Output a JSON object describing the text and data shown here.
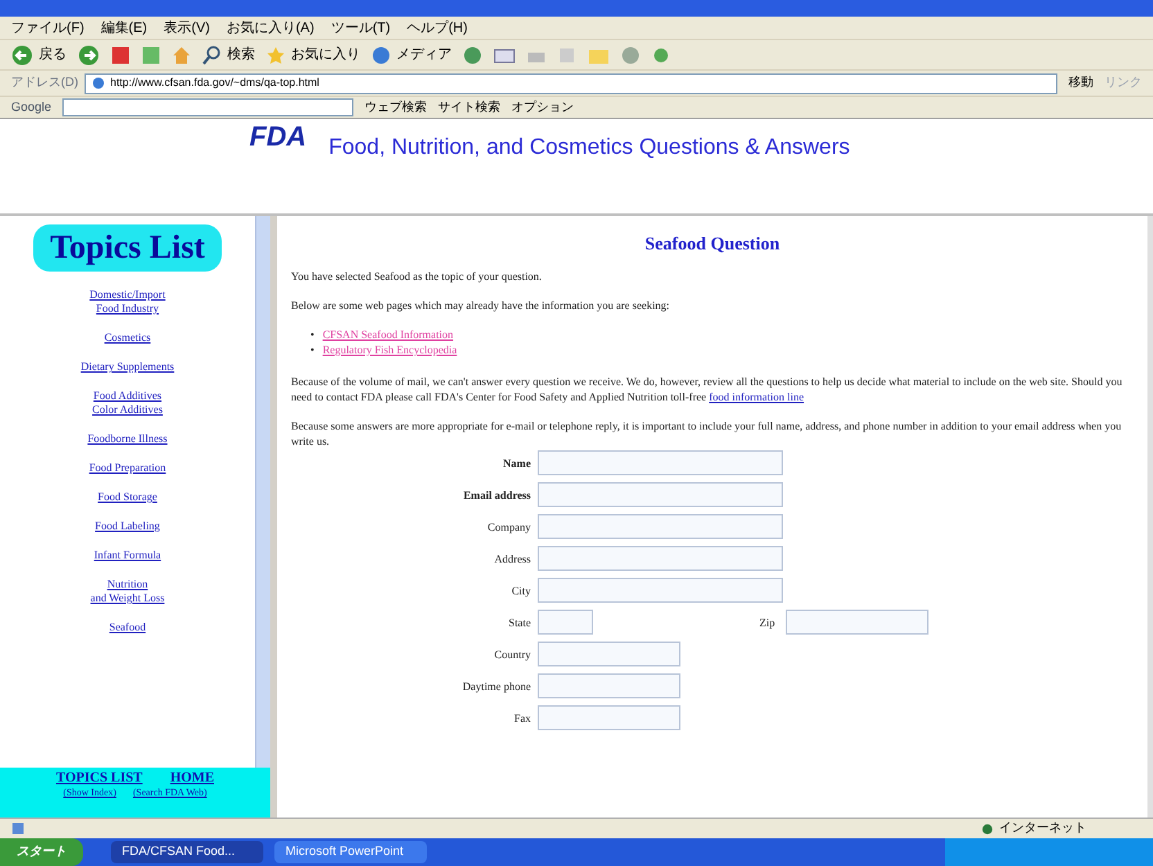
{
  "menu_bar": [
    "ファイル(F)",
    "編集(E)",
    "表示(V)",
    "お気に入り(A)",
    "ツール(T)",
    "ヘルプ(H)"
  ],
  "toolbar": {
    "back": "戻る",
    "search": "検索",
    "favorites": "お気に入り",
    "media": "メディア"
  },
  "address_bar": {
    "label": "アドレス(D)",
    "url": "http://www.cfsan.fda.gov/~dms/qa-top.html",
    "go": "移動",
    "links": "リンク"
  },
  "google_bar": {
    "label": "Google",
    "web_search": "ウェブ検索",
    "site_search": "サイト検索",
    "options": "オプション"
  },
  "banner": {
    "logo": "FDA",
    "title": "Food, Nutrition, and Cosmetics Questions & Answers"
  },
  "sidebar": {
    "title": "Topics List",
    "items": [
      {
        "lines": [
          "Domestic/Import",
          "Food Industry"
        ]
      },
      {
        "lines": [
          "Cosmetics"
        ]
      },
      {
        "lines": [
          "Dietary Supplements"
        ]
      },
      {
        "lines": [
          "Food Additives",
          "Color Additives"
        ]
      },
      {
        "lines": [
          "Foodborne Illness"
        ]
      },
      {
        "lines": [
          "Food Preparation"
        ]
      },
      {
        "lines": [
          "Food Storage"
        ]
      },
      {
        "lines": [
          "Food Labeling"
        ]
      },
      {
        "lines": [
          "Infant Formula"
        ]
      },
      {
        "lines": [
          "Nutrition",
          "and Weight Loss"
        ]
      },
      {
        "lines": [
          "Seafood"
        ]
      }
    ],
    "footer_links": [
      "TOPICS LIST",
      "HOME"
    ],
    "footer_sub": [
      "(Show Index)",
      "(Search FDA Web)"
    ]
  },
  "main": {
    "heading": "Seafood Question",
    "intro": "You have selected Seafood as the topic of your question.",
    "lead": "Below are some web pages which may already have the information you are seeking:",
    "links": [
      {
        "bullet": "•",
        "label": "CFSAN Seafood Information"
      },
      {
        "bullet": "•",
        "label": "Regulatory Fish Encyclopedia"
      }
    ],
    "notice": "Because of the volume of mail, we can't answer every question we receive. We do, however, review all the questions to help us decide what material to include on the web site. Should you need to contact FDA please call FDA's Center for Food Safety and Applied Nutrition toll-free",
    "notice_link": "food information line",
    "contact_note": "Because some answers are more appropriate for e-mail or telephone reply, it is important to include your full name, address, and phone number in addition to your email address when you write us.",
    "form_rows": [
      {
        "fields": [
          {
            "label": "Name",
            "bold": true,
            "kind": "long"
          }
        ]
      },
      {
        "fields": [
          {
            "label": "Email address",
            "bold": true,
            "kind": "long"
          }
        ]
      },
      {
        "fields": [
          {
            "label": "Company",
            "bold": false,
            "kind": "long"
          }
        ]
      },
      {
        "fields": [
          {
            "label": "Address",
            "bold": false,
            "kind": "long"
          }
        ]
      },
      {
        "fields": [
          {
            "label": "City",
            "bold": false,
            "kind": "long"
          }
        ]
      },
      {
        "fields": [
          {
            "label": "State",
            "bold": false,
            "kind": "short"
          },
          {
            "label": "Zip",
            "bold": false,
            "kind": "medium"
          }
        ]
      },
      {
        "fields": [
          {
            "label": "Country",
            "bold": false,
            "kind": "medium"
          }
        ]
      },
      {
        "fields": [
          {
            "label": "Daytime phone",
            "bold": false,
            "kind": "medium"
          }
        ]
      },
      {
        "fields": [
          {
            "label": "Fax",
            "bold": false,
            "kind": "medium"
          }
        ]
      }
    ]
  },
  "status_bar": {
    "zone": "インターネット"
  },
  "taskbar": {
    "start": "スタート",
    "tasks": [
      {
        "label": "FDA/CFSAN Food...",
        "selected": true
      },
      {
        "label": "Microsoft PowerPoint",
        "selected": false
      }
    ]
  }
}
